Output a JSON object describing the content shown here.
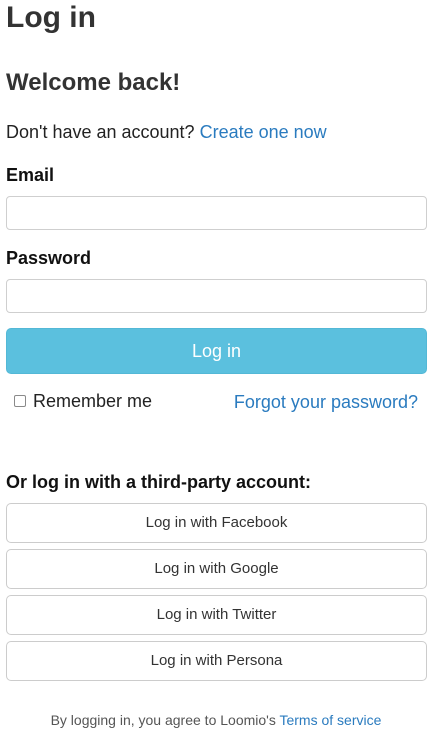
{
  "page": {
    "title": "Log in",
    "welcome": "Welcome back!"
  },
  "signup": {
    "prompt": "Don't have an account?",
    "link": "Create one now"
  },
  "form": {
    "email_label": "Email",
    "email_value": "",
    "password_label": "Password",
    "password_value": "",
    "submit_label": "Log in",
    "remember_label": "Remember me",
    "remember_checked": false,
    "forgot_link": "Forgot your password?"
  },
  "third_party": {
    "heading": "Or log in with a third-party account:",
    "providers": [
      {
        "label": "Log in with Facebook"
      },
      {
        "label": "Log in with Google"
      },
      {
        "label": "Log in with Twitter"
      },
      {
        "label": "Log in with Persona"
      }
    ]
  },
  "footer": {
    "text": "By logging in, you agree to Loomio's",
    "terms_link": "Terms of service"
  },
  "colors": {
    "primary_button": "#5bc0de",
    "link": "#2a7bbf",
    "heading_text": "#333333"
  }
}
